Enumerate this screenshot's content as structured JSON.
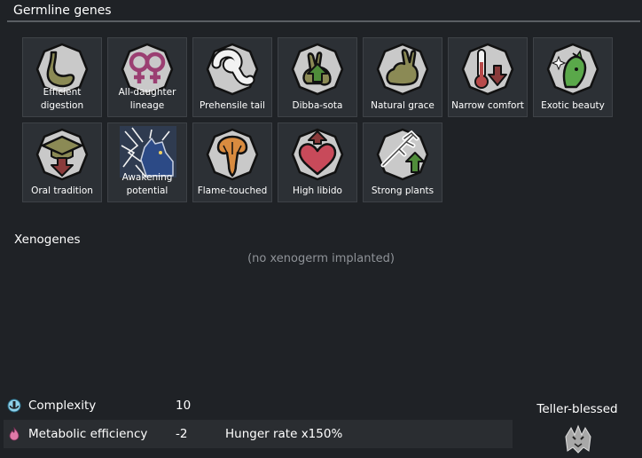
{
  "header": {
    "title": "Germline genes"
  },
  "germline": {
    "genes": [
      {
        "label": "Efficient\ndigestion",
        "icon": "stomach-icon"
      },
      {
        "label": "All-daughter\nlineage",
        "icon": "female-symbols-icon"
      },
      {
        "label": "Prehensile tail",
        "icon": "tail-icon"
      },
      {
        "label": "Dibba-sota",
        "icon": "rabbit-up-icon"
      },
      {
        "label": "Natural grace",
        "icon": "rabbit-icon"
      },
      {
        "label": "Narrow comfort",
        "icon": "thermometer-down-icon"
      },
      {
        "label": "Exotic beauty",
        "icon": "sparkle-face-icon"
      },
      {
        "label": "Oral tradition",
        "icon": "mortarboard-down-icon"
      },
      {
        "label": "Awakening\npotential",
        "icon": "awakening-wolf-icon"
      },
      {
        "label": "Flame-touched",
        "icon": "flame-hand-icon"
      },
      {
        "label": "High libido",
        "icon": "heart-up-icon"
      },
      {
        "label": "Strong plants",
        "icon": "plant-up-icon"
      }
    ]
  },
  "xenogenes": {
    "title": "Xenogenes",
    "empty_text": "(no xenogerm implanted)"
  },
  "stats": {
    "complexity": {
      "name": "Complexity",
      "value": "10",
      "effect": "",
      "icon": "complexity-icon"
    },
    "metabolic": {
      "name": "Metabolic efficiency",
      "value": "-2",
      "effect": "Hunger rate x150%",
      "icon": "metabolism-flame-icon"
    }
  },
  "teller": {
    "label": "Teller-blessed",
    "icon": "teller-beast-icon"
  },
  "colors": {
    "background": "#1f2226",
    "tile": "#2c3035",
    "tile_border": "#3e4247",
    "icon_bg": "#d4d4d4",
    "icon_fill": "#8b8a55",
    "arrow_up": "#4f8c3a",
    "arrow_down": "#8a3b3b",
    "muted_text": "#8f9398"
  }
}
